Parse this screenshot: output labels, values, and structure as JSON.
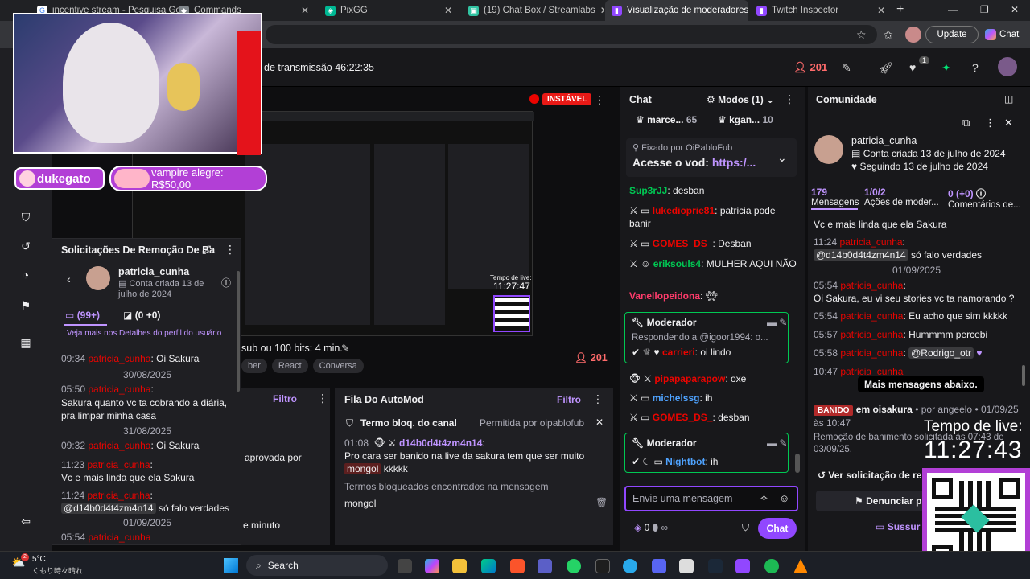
{
  "tabs": [
    {
      "label": "incentive stream - Pesquisa Go",
      "active": false
    },
    {
      "label": "Commands",
      "active": false
    },
    {
      "label": "PixGG",
      "active": false
    },
    {
      "label": "(19) Chat Box / Streamlabs",
      "active": false
    },
    {
      "label": "Visualização de moderadores",
      "active": true
    },
    {
      "label": "Twitch Inspector",
      "active": false
    }
  ],
  "toolbar": {
    "update_label": "Update",
    "chat_label": "Chat"
  },
  "stream_header": {
    "uptime": "de transmissão 46:22:35",
    "viewers": "201"
  },
  "overlay": {
    "follower_name": "dukegato",
    "donation_text": "vampire alegre: R$50,00",
    "live_time_label": "Tempo de live:",
    "live_time_value": "11:27:43",
    "mini_live_time_label": "Tempo de live:",
    "mini_live_time_value": "11:27:47"
  },
  "video": {
    "status": "INSTÁVEL",
    "goal_text": "sub ou 100 bits: 4 min.",
    "tags": [
      "ber",
      "React",
      "Conversa"
    ],
    "viewers": "201"
  },
  "removal_panel": {
    "title": "Solicitações De Remoção De Ba",
    "user": "patricia_cunha",
    "created": "Conta criada 13 de julho de 2024",
    "messages_count": "(99+)",
    "score": "(0 +0)",
    "profile_link": "Veja mais nos Detalhes do perfil do usuário",
    "entries": [
      {
        "time": "09:34",
        "user": "patricia_cunha",
        "text": "Oi Sakura"
      },
      {
        "date": "30/08/2025"
      },
      {
        "time": "05:50",
        "user": "patricia_cunha",
        "text": "Sakura quanto vc ta cobrando a diária, pra limpar minha casa"
      },
      {
        "date": "31/08/2025"
      },
      {
        "time": "09:32",
        "user": "patricia_cunha",
        "text": "Oi Sakura"
      },
      {
        "time": "11:23",
        "user": "patricia_cunha",
        "text": "Vc e mais linda que ela Sakura"
      },
      {
        "time": "11:24",
        "user": "patricia_cunha",
        "mention": "@d14b0d4t4zm4n14",
        "text": "só falo verdades"
      },
      {
        "date": "01/09/2025"
      },
      {
        "time": "05:54",
        "user": "patricia_cunha",
        "text": ""
      }
    ]
  },
  "filter_panel": {
    "filter_label": "Filtro",
    "approved_text": "aprovada por",
    "minute_text": "e minuto"
  },
  "automod": {
    "title": "Fila Do AutoMod",
    "filter_label": "Filtro",
    "term_label": "Termo bloq. do canal",
    "permitted_by": "Permitida por oipablofub",
    "time": "01:08",
    "user": "d14b0d4t4zm4n14",
    "message": "Pro cara ser banido na live da sakura tem que ser muito",
    "highlight": "mongol",
    "tail": "kkkkk",
    "found_label": "Termos bloqueados encontrados na mensagem",
    "term": "mongol"
  },
  "chat": {
    "title": "Chat",
    "modes": "Modos (1)",
    "leaderboard": [
      {
        "name": "marce...",
        "value": "65"
      },
      {
        "name": "kgan...",
        "value": "10"
      }
    ],
    "pinned_by_label": "Fixado por",
    "pinned_by_user": "OiPabloFub",
    "pinned_text": "Acesse o vod:",
    "pinned_link": "https:/...",
    "messages": [
      {
        "user": "Sup3rJJ",
        "text": "desban",
        "color": "green"
      },
      {
        "user": "lukedioprie81",
        "text": "patricia pode banir",
        "color": "red"
      },
      {
        "user": "GOMES_DS_",
        "text": "Desban",
        "color": "red"
      },
      {
        "user": "eriksouls4",
        "text": "MULHER AQUI NÃO",
        "color": "green"
      },
      {
        "user": "Vanellopeidona",
        "text": "",
        "color": "pink"
      }
    ],
    "mod_box_1": {
      "label": "Moderador",
      "reply": "Respondendo a @igoor1994: o...",
      "user": "carrieri",
      "text": "oi lindo"
    },
    "messages2": [
      {
        "user": "pipapaparapow",
        "text": "oxe",
        "color": "red"
      },
      {
        "user": "michelssg",
        "text": "ih",
        "color": "blue"
      },
      {
        "user": "GOMES_DS_",
        "text": "desban",
        "color": "red"
      }
    ],
    "mod_box_2": {
      "label": "Moderador",
      "user": "Nightbot",
      "text": "ih"
    },
    "input_placeholder": "Envie uma mensagem",
    "points": "0",
    "chat_button": "Chat"
  },
  "community": {
    "title": "Comunidade",
    "user": "patricia_cunha",
    "created": "Conta criada 13 de julho de 2024",
    "following": "Seguindo 13 de julho de 2024",
    "stats": [
      {
        "value": "179",
        "label": "Mensagens"
      },
      {
        "value": "1/0/2",
        "label": "Ações de moder..."
      },
      {
        "value": "0 (+0)",
        "label": "Comentários de..."
      }
    ],
    "log": [
      {
        "text": "Vc e mais linda que ela Sakura"
      },
      {
        "time": "11:24",
        "user": "patricia_cunha",
        "mention": "@d14b0d4t4zm4n14",
        "text": "só falo verdades"
      },
      {
        "date": "01/09/2025"
      },
      {
        "time": "05:54",
        "user": "patricia_cunha",
        "text": "Oi Sakura, eu vi seu stories vc ta namorando ?"
      },
      {
        "time": "05:54",
        "user": "patricia_cunha",
        "text": "Eu acho que sim kkkkk"
      },
      {
        "time": "05:57",
        "user": "patricia_cunha",
        "text": "Hummmm percebi"
      },
      {
        "time": "05:58",
        "user": "patricia_cunha",
        "mention": "@Rodrigo_otr",
        "text": ""
      },
      {
        "time": "10:47",
        "user": "patricia_cunha",
        "text": ""
      }
    ],
    "more_below": "Mais mensagens abaixo.",
    "banned_badge": "BANIDO",
    "banned_channel": "em oisakura",
    "banned_by": "• por angeelo • 01/09/25",
    "banned_time": "às 10:47",
    "unban_note": "Remoção de banimento solicitada às 07:43 de 03/09/25.",
    "view_request": "Ver solicitação de re",
    "report_label": "Denunciar p",
    "sus_label": "Sussur"
  },
  "taskbar": {
    "weather_temp": "5°C",
    "weather_desc": "くもり時々晴れ",
    "search": "Search"
  }
}
